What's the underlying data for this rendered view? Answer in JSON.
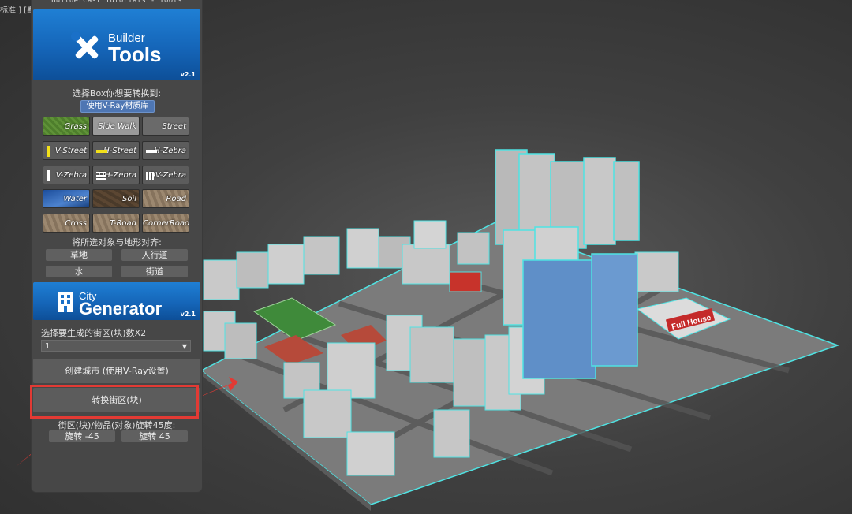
{
  "viewport": {
    "label": "标准 ] [默"
  },
  "panel": {
    "title": "BuilderCast Tutorials - Tools",
    "builder_banner": {
      "line1": "Builder",
      "line2": "Tools",
      "version": "v2.1"
    },
    "convert_label": "选择Box你想要转换到:",
    "vray_button": "使用V-Ray材质库",
    "tiles": [
      {
        "label": "Grass"
      },
      {
        "label": "Side Walk"
      },
      {
        "label": "Street"
      },
      {
        "label": "V-Street"
      },
      {
        "label": "H-Street"
      },
      {
        "label": "H-Zebra"
      },
      {
        "label": "V-Zebra"
      },
      {
        "label": "DH-Zebra"
      },
      {
        "label": "DV-Zebra"
      },
      {
        "label": "Water"
      },
      {
        "label": "Soil"
      },
      {
        "label": "Road"
      },
      {
        "label": "Cross Road"
      },
      {
        "label": "T-Road"
      },
      {
        "label": "CornerRoad"
      }
    ],
    "align_label": "将所选对象与地形对齐:",
    "align_buttons": [
      "草地",
      "人行道",
      "水",
      "街道"
    ],
    "city_banner": {
      "line1": "City",
      "line2": "Generator",
      "version": "v2.1"
    },
    "blocks_label": "选择要生成的街区(块)数X2",
    "blocks_select_value": "1",
    "create_city_button": "创建城市 (使用V-Ray设置)",
    "convert_block_button": "转换街区(块)",
    "rotate_label": "街区(块)/物品(对象)旋转45度:",
    "rotate_buttons": [
      "旋转 -45",
      "旋转 45"
    ]
  },
  "scene": {
    "billboard_text": "Full House"
  },
  "colors": {
    "highlight": "#e23a34",
    "selection_outline": "#4fe3e3",
    "banner_blue": "#1a70c8"
  }
}
